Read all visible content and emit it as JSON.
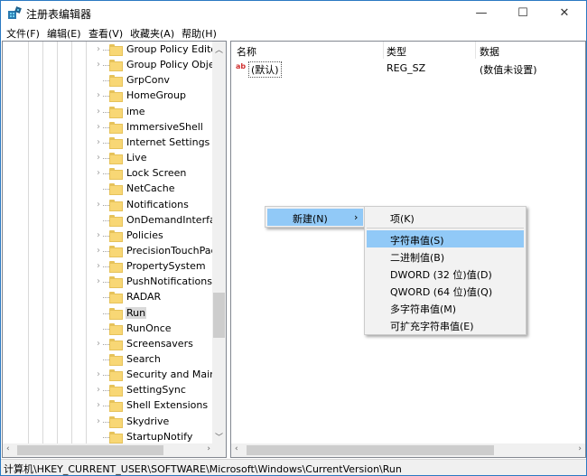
{
  "window": {
    "title": "注册表编辑器",
    "controls": {
      "minimize": "—",
      "maximize": "☐",
      "close": "✕"
    }
  },
  "menu": [
    "文件(F)",
    "编辑(E)",
    "查看(V)",
    "收藏夹(A)",
    "帮助(H)"
  ],
  "tree": {
    "nodes": [
      {
        "label": "Group Policy Editor",
        "expandable": true
      },
      {
        "label": "Group Policy Objec",
        "expandable": true
      },
      {
        "label": "GrpConv",
        "expandable": false
      },
      {
        "label": "HomeGroup",
        "expandable": true
      },
      {
        "label": "ime",
        "expandable": true
      },
      {
        "label": "ImmersiveShell",
        "expandable": true
      },
      {
        "label": "Internet Settings",
        "expandable": true
      },
      {
        "label": "Live",
        "expandable": true
      },
      {
        "label": "Lock Screen",
        "expandable": true
      },
      {
        "label": "NetCache",
        "expandable": false
      },
      {
        "label": "Notifications",
        "expandable": true
      },
      {
        "label": "OnDemandInterface",
        "expandable": false
      },
      {
        "label": "Policies",
        "expandable": true
      },
      {
        "label": "PrecisionTouchPad",
        "expandable": true
      },
      {
        "label": "PropertySystem",
        "expandable": true
      },
      {
        "label": "PushNotifications",
        "expandable": true
      },
      {
        "label": "RADAR",
        "expandable": false
      },
      {
        "label": "Run",
        "expandable": false,
        "selected": true
      },
      {
        "label": "RunOnce",
        "expandable": false
      },
      {
        "label": "Screensavers",
        "expandable": true
      },
      {
        "label": "Search",
        "expandable": false
      },
      {
        "label": "Security and Mainte",
        "expandable": true
      },
      {
        "label": "SettingSync",
        "expandable": true
      },
      {
        "label": "Shell Extensions",
        "expandable": true
      },
      {
        "label": "Skydrive",
        "expandable": true
      },
      {
        "label": "StartupNotify",
        "expandable": false
      }
    ]
  },
  "list": {
    "columns": [
      "名称",
      "类型",
      "数据"
    ],
    "rows": [
      {
        "icon": "ab",
        "name": "(默认)",
        "type": "REG_SZ",
        "data": "(数值未设置)"
      }
    ]
  },
  "context_menu": {
    "parent_item": "新建(N)",
    "submenu_arrow": "›",
    "submenu": [
      {
        "label": "项(K)",
        "separator_after": true
      },
      {
        "label": "字符串值(S)",
        "highlighted": true
      },
      {
        "label": "二进制值(B)"
      },
      {
        "label": "DWORD (32 位)值(D)"
      },
      {
        "label": "QWORD (64 位)值(Q)"
      },
      {
        "label": "多字符串值(M)"
      },
      {
        "label": "可扩充字符串值(E)"
      }
    ]
  },
  "status_bar": {
    "path": "计算机\\HKEY_CURRENT_USER\\SOFTWARE\\Microsoft\\Windows\\CurrentVersion\\Run"
  },
  "colors": {
    "window_border": "#2b79c2",
    "menu_highlight": "#91c9f7",
    "folder": "#f8d775",
    "selected_node": "#d9d9d9"
  }
}
